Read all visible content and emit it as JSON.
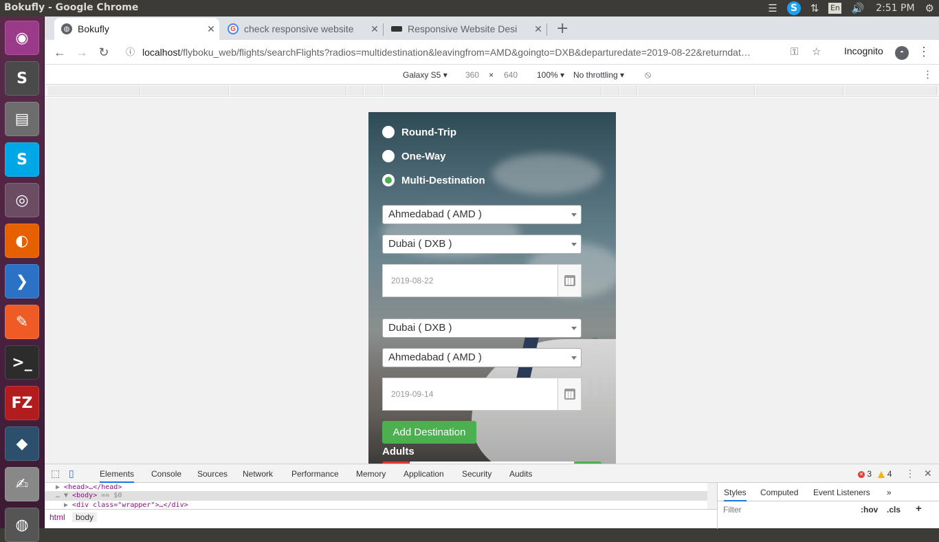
{
  "os": {
    "window_title": "Bokufly - Google Chrome",
    "keyboard_layout": "En",
    "clock": "2:51 PM"
  },
  "launcher": {
    "items": [
      {
        "name": "ubuntu-dash-icon",
        "glyph": "◉",
        "color": "#9c3a8a"
      },
      {
        "name": "sublime-text-icon",
        "glyph": "S",
        "color": "#4a4a4a"
      },
      {
        "name": "files-icon",
        "glyph": "▤",
        "color": "#6d6d6d"
      },
      {
        "name": "skype-icon",
        "glyph": "S",
        "color": "#00a7e7"
      },
      {
        "name": "chrome-icon",
        "glyph": "◎",
        "color": "#6b4d63"
      },
      {
        "name": "firefox-icon",
        "glyph": "◐",
        "color": "#e66000"
      },
      {
        "name": "vscode-icon",
        "glyph": "❯",
        "color": "#2b72c6"
      },
      {
        "name": "postman-icon",
        "glyph": "✎",
        "color": "#ef5b25"
      },
      {
        "name": "terminal-icon",
        "glyph": ">_",
        "color": "#2c2c2c"
      },
      {
        "name": "filezilla-icon",
        "glyph": "FZ",
        "color": "#b11d1d"
      },
      {
        "name": "mysql-workbench-icon",
        "glyph": "◆",
        "color": "#2c4f6e"
      },
      {
        "name": "text-editor-icon",
        "glyph": "✍",
        "color": "#888"
      },
      {
        "name": "disk-icon",
        "glyph": "◍",
        "color": "#555"
      }
    ]
  },
  "browser": {
    "tabs": [
      {
        "label": "Bokufly",
        "active": true
      },
      {
        "label": "check responsive website",
        "active": false
      },
      {
        "label": "Responsive Website Desi",
        "active": false
      }
    ],
    "url_host": "localhost",
    "url_path": "/flyboku_web/flights/searchFlights?radios=multidestination&leavingfrom=AMD&goingto=DXB&departuredate=2019-08-22&returndat…",
    "incognito_label": "Incognito"
  },
  "device_toolbar": {
    "device": "Galaxy S5",
    "width": "360",
    "times": "×",
    "height": "640",
    "zoom": "100%",
    "throttling": "No throttling"
  },
  "page": {
    "trip_options": [
      {
        "label": "Round-Trip",
        "checked": false
      },
      {
        "label": "One-Way",
        "checked": false
      },
      {
        "label": "Multi-Destination",
        "checked": true
      }
    ],
    "leg1": {
      "from": "Ahmedabad ( AMD )",
      "to": "Dubai ( DXB )",
      "date": "2019-08-22"
    },
    "leg2": {
      "from": "Dubai ( DXB )",
      "to": "Ahmedabad ( AMD )",
      "date": "2019-09-14"
    },
    "add_destination_label": "Add Destination",
    "adults_label": "Adults"
  },
  "devtools": {
    "tabs": [
      "Elements",
      "Console",
      "Sources",
      "Network",
      "Performance",
      "Memory",
      "Application",
      "Security",
      "Audits"
    ],
    "error_count": "3",
    "warning_count": "4",
    "dom_lines": {
      "head": "<head>…</head>",
      "body": "<body>",
      "body_suffix": "== $0",
      "div": "<div class=\"wrapper\">…</div>"
    },
    "breadcrumbs": [
      "html",
      "body"
    ],
    "styles_tabs": [
      "Styles",
      "Computed",
      "Event Listeners"
    ],
    "filter_placeholder": "Filter",
    "hov_label": ":hov",
    "cls_label": ".cls"
  }
}
